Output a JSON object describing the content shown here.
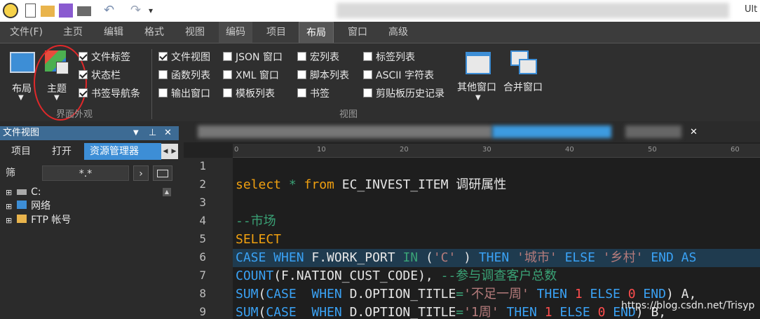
{
  "menu": {
    "items": [
      "文件(F)",
      "主页",
      "编辑",
      "格式",
      "视图",
      "编码",
      "项目",
      "布局",
      "窗口",
      "高级"
    ],
    "active": "布局",
    "right_partial": "Ult"
  },
  "ribbon": {
    "layout_btn": "布局",
    "theme_btn": "主题",
    "group1_checks": [
      {
        "label": "文件标签",
        "checked": true
      },
      {
        "label": "状态栏",
        "checked": true
      },
      {
        "label": "书签导航条",
        "checked": true
      }
    ],
    "group1_label": "界面外观",
    "view_checks": [
      {
        "label": "文件视图",
        "checked": true
      },
      {
        "label": "函数列表",
        "checked": false
      },
      {
        "label": "输出窗口",
        "checked": false
      },
      {
        "label": "JSON 窗口",
        "checked": false
      },
      {
        "label": "XML 窗口",
        "checked": false
      },
      {
        "label": "模板列表",
        "checked": false
      },
      {
        "label": "宏列表",
        "checked": false
      },
      {
        "label": "脚本列表",
        "checked": false
      },
      {
        "label": "书签",
        "checked": false
      },
      {
        "label": "标签列表",
        "checked": false
      },
      {
        "label": "ASCII 字符表",
        "checked": false
      },
      {
        "label": "剪贴板历史记录",
        "checked": false
      }
    ],
    "other_window": "其他窗口",
    "merge_window": "合并窗口",
    "group2_label": "视图"
  },
  "panel": {
    "title": "文件视图",
    "tabs": [
      "项目",
      "打开",
      "资源管理器"
    ],
    "active_tab": "资源管理器",
    "filter_label": "筛",
    "filter_value": "*.*",
    "tree": [
      "C:",
      "网络",
      "FTP 帐号"
    ]
  },
  "editor": {
    "ruler_marks": [
      "0",
      "10",
      "20",
      "30",
      "40",
      "50",
      "60"
    ],
    "line_numbers": [
      "1",
      "2",
      "3",
      "4",
      "5",
      "6",
      "7",
      "8",
      "9"
    ],
    "code": {
      "l2_kw1": "select",
      "l2_star": " * ",
      "l2_kw2": "from",
      "l2_rest": " EC_INVEST_ITEM 调研属性",
      "l4": "--市场",
      "l5": "SELECT",
      "l6_case": "CASE WHEN",
      "l6_a": " F.WORK_PORT ",
      "l6_in": "IN",
      "l6_b": " (",
      "l6_s1": "'C'",
      "l6_c": " ) ",
      "l6_then": "THEN",
      "l6_s2": " '城市' ",
      "l6_else": "ELSE",
      "l6_s3": " '乡村' ",
      "l6_end": "END AS",
      "l7_a": "COUNT",
      "l7_b": "(F.NATION_CUST_CODE), ",
      "l7_c": "--参与调查客户总数",
      "l8_sum": "SUM",
      "l8_a": "(",
      "l8_case": "CASE  WHEN",
      "l8_b": " D.OPTION_TITLE",
      "l8_eq": "=",
      "l8_s": "'不足一周'",
      "l8_then": " THEN ",
      "l8_n1": "1",
      "l8_else": " ELSE ",
      "l8_n0": "0",
      "l8_end": " END",
      "l8_tail": ") A,",
      "l9_s": "'1周'",
      "l9_tail": ") B,"
    }
  },
  "watermark": "https://blog.csdn.net/Trisyp",
  "colors": {
    "accent": "#3d8ed6",
    "keyword": "#f0a010",
    "keyword_blue": "#3aa2f5",
    "string": "#b47b7b",
    "comment": "#3aa276",
    "number": "#ff4d4d",
    "highlight": "#1f3b4f"
  }
}
